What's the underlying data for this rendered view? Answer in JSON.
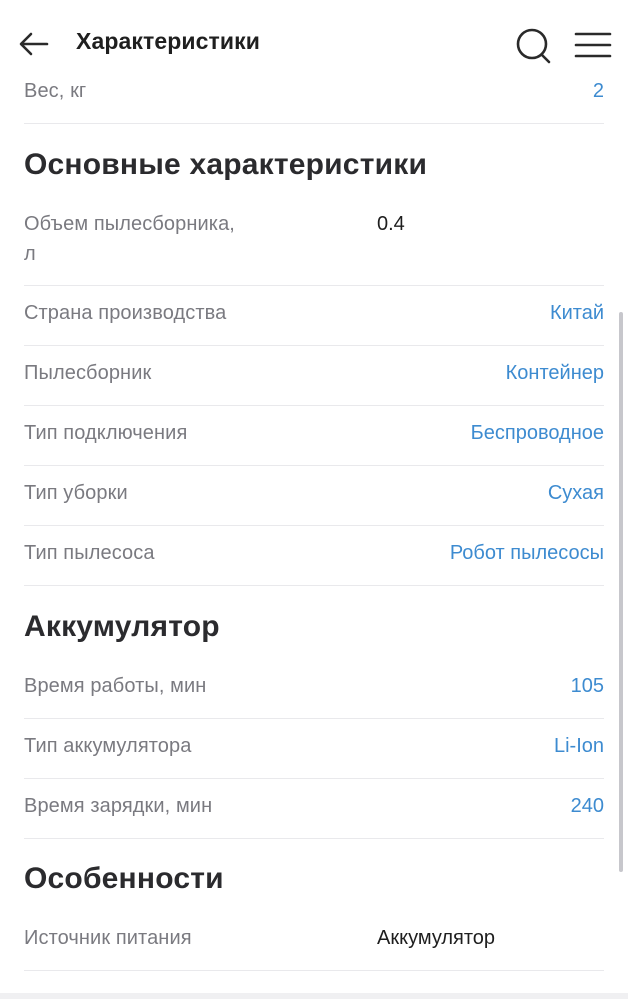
{
  "header": {
    "title": "Характеристики",
    "back_icon": "arrow-left-icon",
    "search_icon": "search-icon",
    "menu_icon": "hamburger-menu-icon"
  },
  "top_row": {
    "label": "Вес, кг",
    "value": "2"
  },
  "sections": [
    {
      "title": "Основные характеристики",
      "rows": [
        {
          "label_line1": "Объем пылесборника,",
          "label_line2": "л",
          "value": "0.4"
        },
        {
          "label": "Страна производства",
          "value": "Китай"
        },
        {
          "label": "Пылесборник",
          "value": "Контейнер"
        },
        {
          "label": "Тип подключения",
          "value": "Беспроводное"
        },
        {
          "label": "Тип уборки",
          "value": "Сухая"
        },
        {
          "label": "Тип пылесоса",
          "value": "Робот пылесосы"
        }
      ]
    },
    {
      "title": "Аккумулятор",
      "rows": [
        {
          "label": "Время работы, мин",
          "value": "105"
        },
        {
          "label": "Тип аккумулятора",
          "value": "Li-Ion"
        },
        {
          "label": "Время зарядки, мин",
          "value": "240"
        }
      ]
    },
    {
      "title": "Особенности",
      "rows": [
        {
          "label": "Источник питания",
          "value": "Аккумулятор"
        }
      ]
    }
  ],
  "colors": {
    "link": "#3d8bd0",
    "label": "#7a7a80",
    "title": "#2b2b2e"
  }
}
